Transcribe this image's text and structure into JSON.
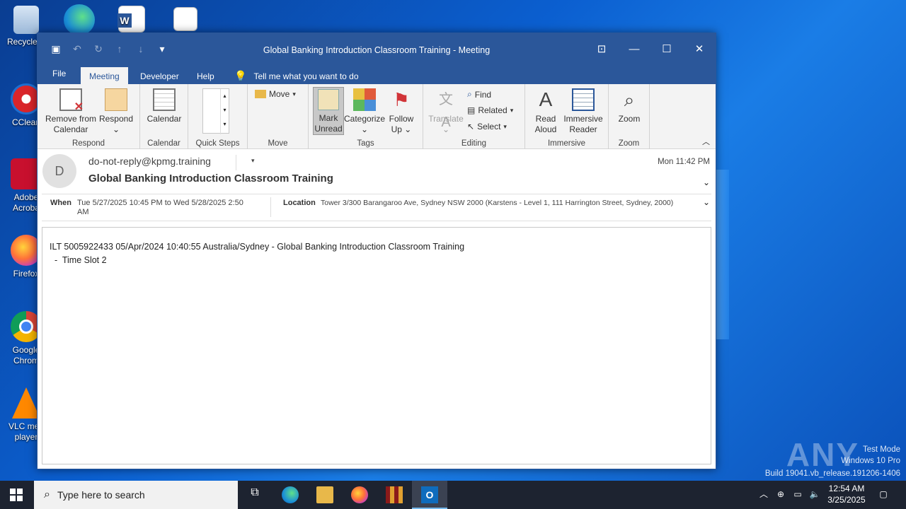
{
  "desktop": {
    "icons": [
      {
        "label": "Recycle Bin",
        "short": "Recycle B"
      },
      {
        "label": "CCleaner",
        "short": "CClean"
      },
      {
        "label": "Adobe Acrobat",
        "line1": "Adobe",
        "line2": "Acroba"
      },
      {
        "label": "Firefox",
        "short": "Firefox"
      },
      {
        "label": "Google Chrome",
        "line1": "Google",
        "line2": "Chrom"
      },
      {
        "label": "VLC media player",
        "line1": "VLC med",
        "line2": "player"
      }
    ]
  },
  "window": {
    "title": "Global Banking Introduction Classroom Training  -  Meeting"
  },
  "tabs": [
    {
      "label": "File"
    },
    {
      "label": "Meeting"
    },
    {
      "label": "Developer"
    },
    {
      "label": "Help"
    }
  ],
  "tell_me": "Tell me what you want to do",
  "ribbon": {
    "respond": {
      "label": "Respond",
      "remove_line1": "Remove from",
      "remove_line2": "Calendar",
      "respond": "Respond"
    },
    "calendar": {
      "label": "Calendar",
      "btn": "Calendar"
    },
    "quick_steps": {
      "label": "Quick Steps"
    },
    "move": {
      "label": "Move",
      "btn": "Move"
    },
    "tags": {
      "label": "Tags",
      "mark_line1": "Mark",
      "mark_line2": "Unread",
      "categorize": "Categorize",
      "follow_line1": "Follow",
      "follow_line2": "Up"
    },
    "editing": {
      "label": "Editing",
      "translate": "Translate",
      "find": "Find",
      "related": "Related",
      "select": "Select"
    },
    "immersive": {
      "label": "Immersive",
      "read_line1": "Read",
      "read_line2": "Aloud",
      "ir_line1": "Immersive",
      "ir_line2": "Reader"
    },
    "zoom": {
      "label": "Zoom",
      "btn": "Zoom"
    }
  },
  "message": {
    "avatar": "D",
    "from": "do-not-reply@kpmg.training",
    "subject": "Global Banking Introduction Classroom Training",
    "date": "Mon 11:42 PM",
    "when_label": "When",
    "when": "Tue 5/27/2025 10:45 PM to Wed 5/28/2025 2:50 AM",
    "location_label": "Location",
    "location": "Tower 3/300 Barangaroo Ave, Sydney NSW 2000 (Karstens - Level 1, 111 Harrington Street, Sydney, 2000)",
    "body_line1": "ILT 5005922433  05/Apr/2024 10:40:55  Australia/Sydney  -  Global Banking Introduction Classroom Training",
    "body_line2": "  -  Time Slot 2"
  },
  "taskbar": {
    "search_placeholder": "Type here to search",
    "time": "12:54 AM",
    "date": "3/25/2025"
  },
  "watermark": {
    "brand": "ANY RUN",
    "mode": "Test Mode",
    "os": "Windows 10 Pro",
    "build": "Build 19041.vb_release.191206-1406"
  }
}
